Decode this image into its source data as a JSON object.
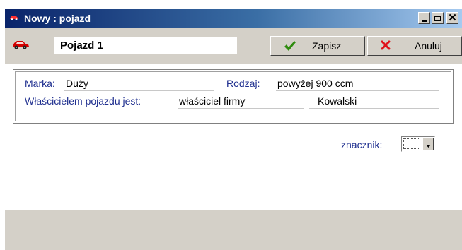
{
  "window": {
    "title": "Nowy : pojazd"
  },
  "toolbar": {
    "vehicle_name": "Pojazd 1",
    "save_label": "Zapisz",
    "cancel_label": "Anuluj"
  },
  "details": {
    "marka_label": "Marka:",
    "marka_value": "Duży",
    "rodzaj_label": "Rodzaj:",
    "rodzaj_value": "powyżej 900 ccm",
    "owner_label": "Właścicielem pojazdu jest:",
    "owner_type_value": "właściciel firmy",
    "owner_name_value": "Kowalski"
  },
  "tag": {
    "label": "znacznik:",
    "value": ""
  },
  "colors": {
    "accent_titlebar": "#0a246a",
    "label_text": "#1f2f8f",
    "save_icon": "#2e8b0e",
    "cancel_icon": "#e0101a",
    "car_icon": "#d40000"
  },
  "icons": [
    "car-icon",
    "checkmark-icon",
    "x-icon",
    "minimize-icon",
    "maximize-icon",
    "close-icon",
    "chevron-down-icon"
  ]
}
